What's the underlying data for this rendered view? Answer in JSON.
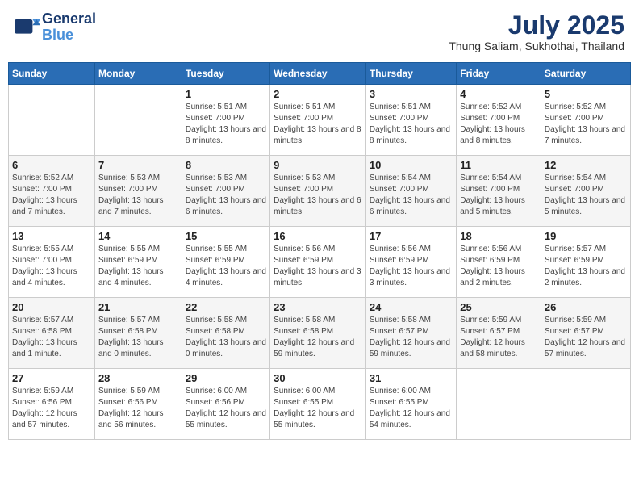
{
  "header": {
    "logo_line1": "General",
    "logo_line2": "Blue",
    "month_year": "July 2025",
    "location": "Thung Saliam, Sukhothai, Thailand"
  },
  "weekdays": [
    "Sunday",
    "Monday",
    "Tuesday",
    "Wednesday",
    "Thursday",
    "Friday",
    "Saturday"
  ],
  "weeks": [
    [
      {
        "day": "",
        "info": ""
      },
      {
        "day": "",
        "info": ""
      },
      {
        "day": "1",
        "info": "Sunrise: 5:51 AM\nSunset: 7:00 PM\nDaylight: 13 hours and 8 minutes."
      },
      {
        "day": "2",
        "info": "Sunrise: 5:51 AM\nSunset: 7:00 PM\nDaylight: 13 hours and 8 minutes."
      },
      {
        "day": "3",
        "info": "Sunrise: 5:51 AM\nSunset: 7:00 PM\nDaylight: 13 hours and 8 minutes."
      },
      {
        "day": "4",
        "info": "Sunrise: 5:52 AM\nSunset: 7:00 PM\nDaylight: 13 hours and 8 minutes."
      },
      {
        "day": "5",
        "info": "Sunrise: 5:52 AM\nSunset: 7:00 PM\nDaylight: 13 hours and 7 minutes."
      }
    ],
    [
      {
        "day": "6",
        "info": "Sunrise: 5:52 AM\nSunset: 7:00 PM\nDaylight: 13 hours and 7 minutes."
      },
      {
        "day": "7",
        "info": "Sunrise: 5:53 AM\nSunset: 7:00 PM\nDaylight: 13 hours and 7 minutes."
      },
      {
        "day": "8",
        "info": "Sunrise: 5:53 AM\nSunset: 7:00 PM\nDaylight: 13 hours and 6 minutes."
      },
      {
        "day": "9",
        "info": "Sunrise: 5:53 AM\nSunset: 7:00 PM\nDaylight: 13 hours and 6 minutes."
      },
      {
        "day": "10",
        "info": "Sunrise: 5:54 AM\nSunset: 7:00 PM\nDaylight: 13 hours and 6 minutes."
      },
      {
        "day": "11",
        "info": "Sunrise: 5:54 AM\nSunset: 7:00 PM\nDaylight: 13 hours and 5 minutes."
      },
      {
        "day": "12",
        "info": "Sunrise: 5:54 AM\nSunset: 7:00 PM\nDaylight: 13 hours and 5 minutes."
      }
    ],
    [
      {
        "day": "13",
        "info": "Sunrise: 5:55 AM\nSunset: 7:00 PM\nDaylight: 13 hours and 4 minutes."
      },
      {
        "day": "14",
        "info": "Sunrise: 5:55 AM\nSunset: 6:59 PM\nDaylight: 13 hours and 4 minutes."
      },
      {
        "day": "15",
        "info": "Sunrise: 5:55 AM\nSunset: 6:59 PM\nDaylight: 13 hours and 4 minutes."
      },
      {
        "day": "16",
        "info": "Sunrise: 5:56 AM\nSunset: 6:59 PM\nDaylight: 13 hours and 3 minutes."
      },
      {
        "day": "17",
        "info": "Sunrise: 5:56 AM\nSunset: 6:59 PM\nDaylight: 13 hours and 3 minutes."
      },
      {
        "day": "18",
        "info": "Sunrise: 5:56 AM\nSunset: 6:59 PM\nDaylight: 13 hours and 2 minutes."
      },
      {
        "day": "19",
        "info": "Sunrise: 5:57 AM\nSunset: 6:59 PM\nDaylight: 13 hours and 2 minutes."
      }
    ],
    [
      {
        "day": "20",
        "info": "Sunrise: 5:57 AM\nSunset: 6:58 PM\nDaylight: 13 hours and 1 minute."
      },
      {
        "day": "21",
        "info": "Sunrise: 5:57 AM\nSunset: 6:58 PM\nDaylight: 13 hours and 0 minutes."
      },
      {
        "day": "22",
        "info": "Sunrise: 5:58 AM\nSunset: 6:58 PM\nDaylight: 13 hours and 0 minutes."
      },
      {
        "day": "23",
        "info": "Sunrise: 5:58 AM\nSunset: 6:58 PM\nDaylight: 12 hours and 59 minutes."
      },
      {
        "day": "24",
        "info": "Sunrise: 5:58 AM\nSunset: 6:57 PM\nDaylight: 12 hours and 59 minutes."
      },
      {
        "day": "25",
        "info": "Sunrise: 5:59 AM\nSunset: 6:57 PM\nDaylight: 12 hours and 58 minutes."
      },
      {
        "day": "26",
        "info": "Sunrise: 5:59 AM\nSunset: 6:57 PM\nDaylight: 12 hours and 57 minutes."
      }
    ],
    [
      {
        "day": "27",
        "info": "Sunrise: 5:59 AM\nSunset: 6:56 PM\nDaylight: 12 hours and 57 minutes."
      },
      {
        "day": "28",
        "info": "Sunrise: 5:59 AM\nSunset: 6:56 PM\nDaylight: 12 hours and 56 minutes."
      },
      {
        "day": "29",
        "info": "Sunrise: 6:00 AM\nSunset: 6:56 PM\nDaylight: 12 hours and 55 minutes."
      },
      {
        "day": "30",
        "info": "Sunrise: 6:00 AM\nSunset: 6:55 PM\nDaylight: 12 hours and 55 minutes."
      },
      {
        "day": "31",
        "info": "Sunrise: 6:00 AM\nSunset: 6:55 PM\nDaylight: 12 hours and 54 minutes."
      },
      {
        "day": "",
        "info": ""
      },
      {
        "day": "",
        "info": ""
      }
    ]
  ]
}
